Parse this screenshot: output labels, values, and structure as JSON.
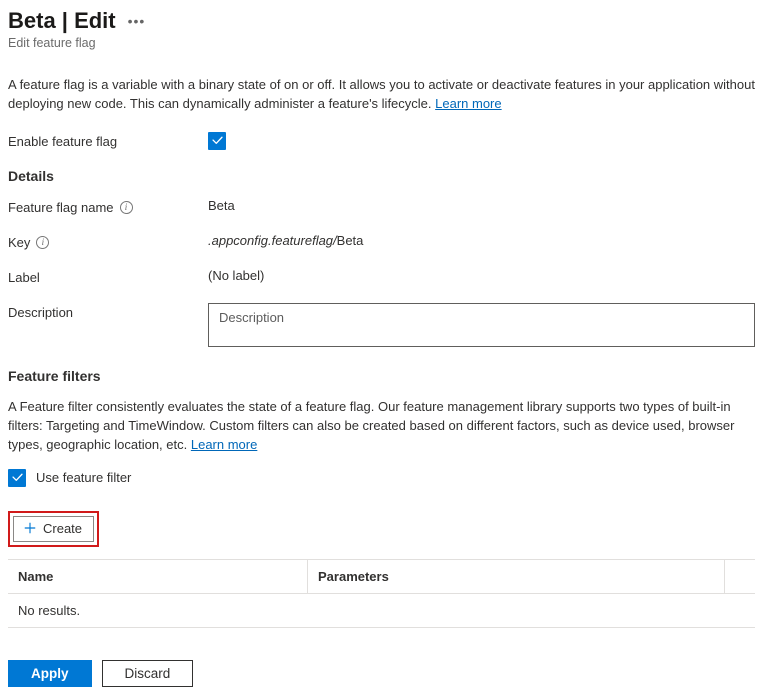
{
  "header": {
    "title": "Beta | Edit",
    "subtitle": "Edit feature flag"
  },
  "intro": {
    "text": "A feature flag is a variable with a binary state of on or off. It allows you to activate or deactivate features in your application without deploying new code. This can dynamically administer a feature's lifecycle.",
    "learnMore": "Learn more"
  },
  "enable": {
    "label": "Enable feature flag",
    "checked": true
  },
  "details": {
    "sectionTitle": "Details",
    "fields": {
      "nameLabel": "Feature flag name",
      "nameValue": "Beta",
      "keyLabel": "Key",
      "keyPrefix": ".appconfig.featureflag/",
      "keySuffix": "Beta",
      "labelLabel": "Label",
      "labelValue": "(No label)",
      "descLabel": "Description",
      "descPlaceholder": "Description"
    }
  },
  "filters": {
    "sectionTitle": "Feature filters",
    "text": "A Feature filter consistently evaluates the state of a feature flag. Our feature management library supports two types of built-in filters: Targeting and TimeWindow. Custom filters can also be created based on different factors, such as device used, browser types, geographic location, etc.",
    "learnMore": "Learn more",
    "useFilterLabel": "Use feature filter",
    "useFilterChecked": true,
    "createLabel": "Create",
    "table": {
      "colName": "Name",
      "colParams": "Parameters",
      "emptyText": "No results."
    }
  },
  "footer": {
    "apply": "Apply",
    "discard": "Discard"
  }
}
